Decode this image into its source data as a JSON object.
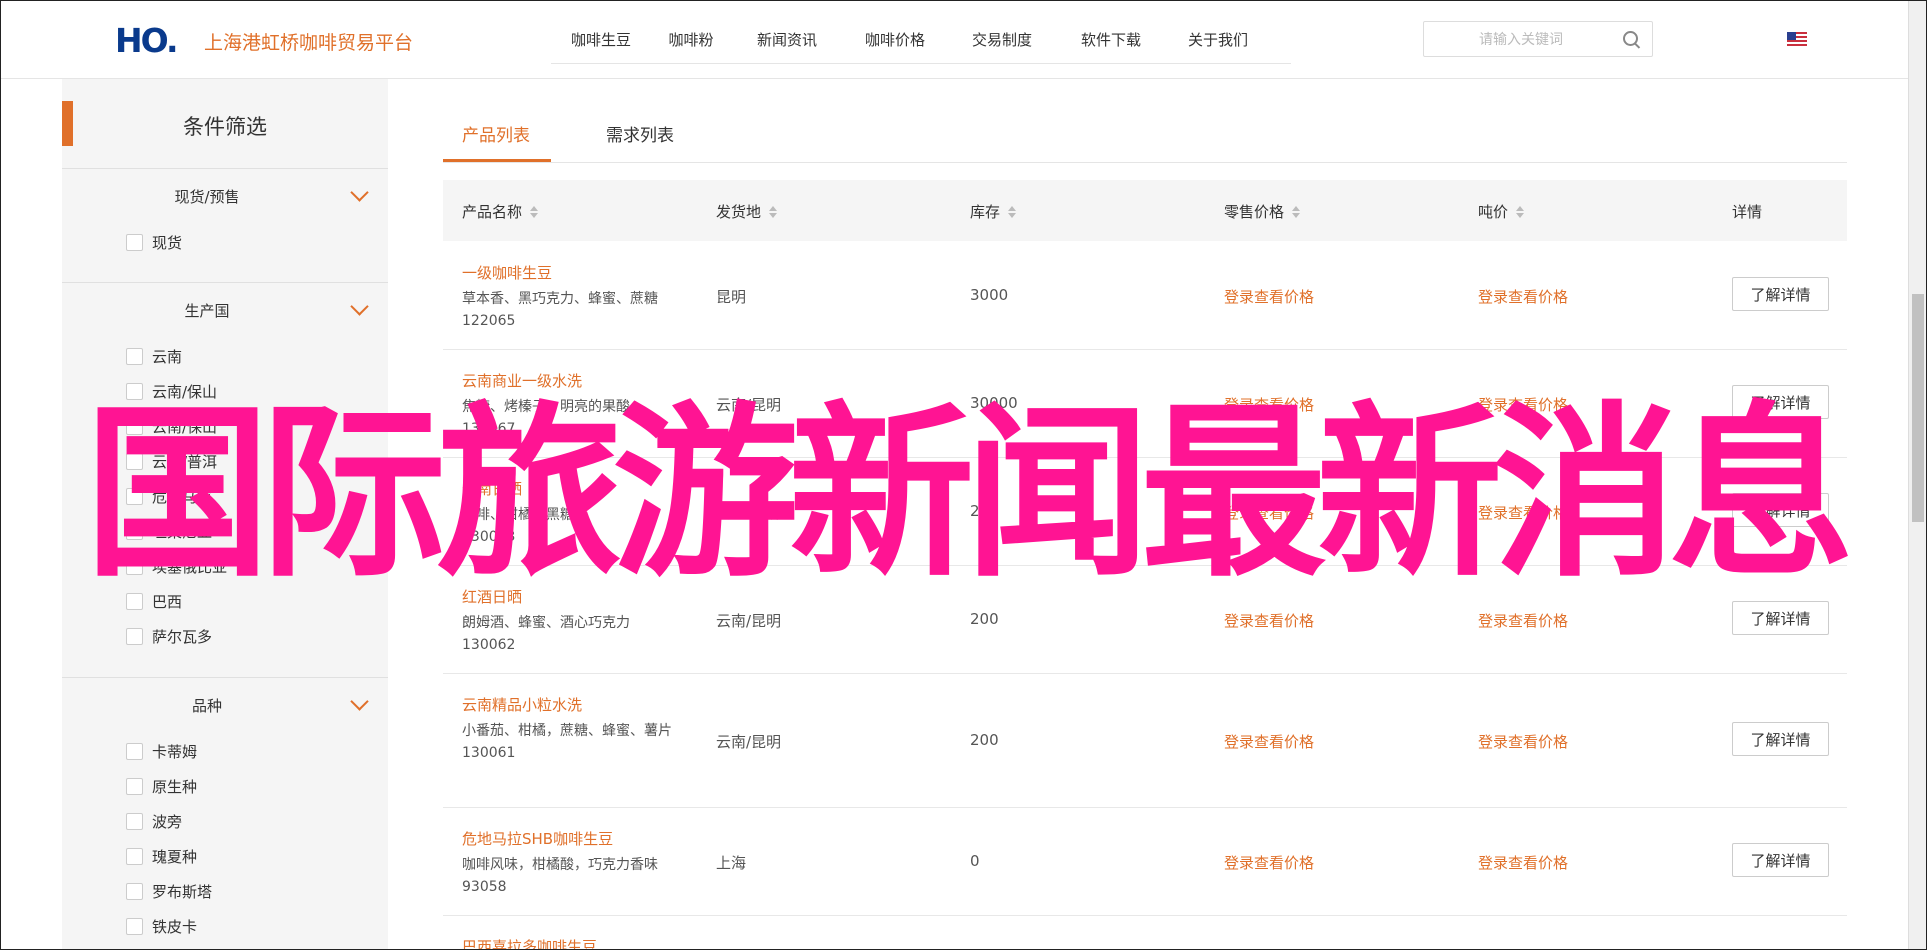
{
  "header": {
    "logo_text": "HO.",
    "brand": "上海港虹桥咖啡贸易平台",
    "nav": [
      "咖啡生豆",
      "咖啡粉",
      "新闻资讯",
      "咖啡价格",
      "交易制度",
      "软件下载",
      "关于我们"
    ],
    "search_placeholder": "请输入关键词",
    "flag_icon": "us-flag-icon"
  },
  "sidebar": {
    "title": "条件筛选",
    "groups": [
      {
        "title": "现货/预售",
        "options": [
          "现货"
        ]
      },
      {
        "title": "生产国",
        "options": [
          "云南",
          "云南/保山",
          "云南/保山",
          "云南/普洱",
          "危地马拉",
          "坦桑尼亚",
          "埃塞俄比亚",
          "巴西",
          "萨尔瓦多"
        ]
      },
      {
        "title": "品种",
        "options": [
          "卡蒂姆",
          "原生种",
          "波旁",
          "瑰夏种",
          "罗布斯塔",
          "铁皮卡"
        ]
      }
    ]
  },
  "tabs": [
    "产品列表",
    "需求列表"
  ],
  "table": {
    "headers": [
      "产品名称",
      "发货地",
      "库存",
      "零售价格",
      "吨价",
      "详情"
    ],
    "rows": [
      {
        "name": "一级咖啡生豆",
        "desc": "草本香、黑巧克力、蜂蜜、蔗糖",
        "id": "122065",
        "origin": "昆明",
        "stock": "3000",
        "retail": "登录查看价格",
        "ton": "登录查看价格",
        "detail": "了解详情"
      },
      {
        "name": "云南商业一级水洗",
        "desc": "焦糖、烤榛子，明亮的果酸",
        "id": "130067",
        "origin": "云南/昆明",
        "stock": "30000",
        "retail": "登录查看价格",
        "ton": "登录查看价格",
        "detail": "了解详情"
      },
      {
        "name": "云南日晒",
        "desc": "咖啡、柑橘、黑糖",
        "id": "130063",
        "origin": "云南/昆明",
        "stock": "200",
        "retail": "登录查看价格",
        "ton": "登录查看价格",
        "detail": "了解详情"
      },
      {
        "name": "红酒日晒",
        "desc": "朗姆酒、蜂蜜、酒心巧克力",
        "id": "130062",
        "origin": "云南/昆明",
        "stock": "200",
        "retail": "登录查看价格",
        "ton": "登录查看价格",
        "detail": "了解详情"
      },
      {
        "name": "云南精品小粒水洗",
        "desc": "小番茄、柑橘，蔗糖、蜂蜜、薯片",
        "id": "130061",
        "origin": "云南/昆明",
        "stock": "200",
        "retail": "登录查看价格",
        "ton": "登录查看价格",
        "detail": "了解详情"
      },
      {
        "name": "危地马拉SHB咖啡生豆",
        "desc": "咖啡风味，柑橘酸，巧克力香味",
        "id": "93058",
        "origin": "上海",
        "stock": "0",
        "retail": "登录查看价格",
        "ton": "登录查看价格",
        "detail": "了解详情"
      },
      {
        "name": "巴西喜拉多咖啡生豆",
        "desc": "",
        "id": "",
        "origin": "",
        "stock": "",
        "retail": "",
        "ton": "",
        "detail": ""
      }
    ]
  },
  "overlay_text": "国际旅游新闻最新消息",
  "colors": {
    "accent": "#e0702a",
    "overlay": "#ff1493",
    "logo": "#0a3a8c"
  }
}
